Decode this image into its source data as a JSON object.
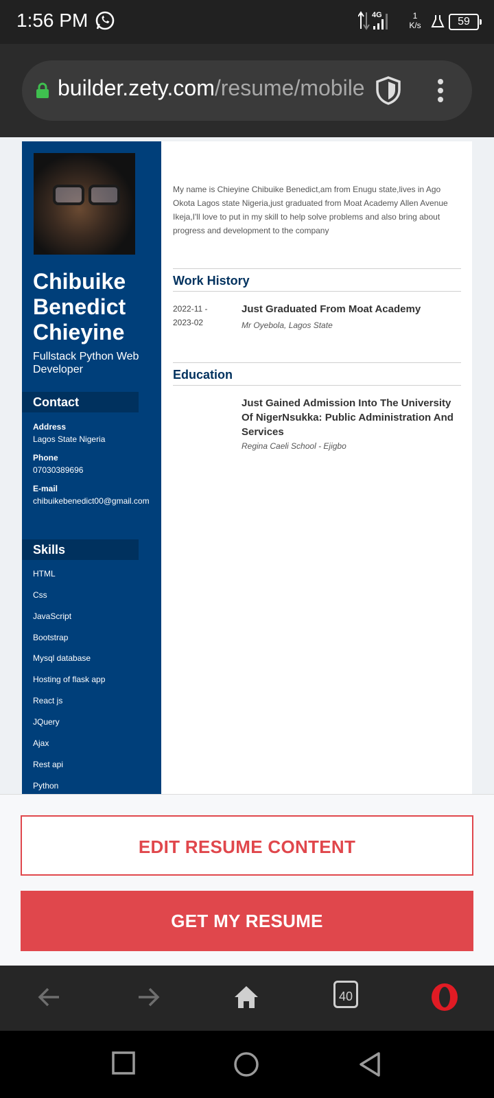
{
  "status_bar": {
    "time": "1:56 PM",
    "network": "4G",
    "speed_value": "1",
    "speed_unit": "K/s",
    "battery": "59"
  },
  "browser": {
    "url_host": "builder.zety.com",
    "url_path": "/resume/mobile",
    "tab_count": "40"
  },
  "resume": {
    "name": "Chibuike Benedict Chieyine",
    "role": "Fullstack Python Web Developer",
    "summary": "My name is Chieyine Chibuike Benedict,am from Enugu state,lives in Ago Okota Lagos state Nigeria,just graduated from Moat Academy Allen Avenue Ikeja,I'll love to put in my skill to help solve problems and also bring about progress and development to the company",
    "contact": {
      "heading": "Contact",
      "address_label": "Address",
      "address": "Lagos State Nigeria",
      "phone_label": "Phone",
      "phone": "07030389696",
      "email_label": "E-mail",
      "email": "chibuikebenedict00@gmail.com"
    },
    "skills": {
      "heading": "Skills",
      "items": [
        "HTML",
        "Css",
        "JavaScript",
        "Bootstrap",
        "Mysql database",
        "Hosting of flask app",
        "React js",
        "JQuery",
        "Ajax",
        "Rest api",
        "Python"
      ]
    },
    "work_history": {
      "heading": "Work History",
      "date_start": "2022-11 -",
      "date_end": "2023-02",
      "title": "Just Graduated From Moat Academy",
      "sub": "Mr Oyebola, Lagos State"
    },
    "education": {
      "heading": "Education",
      "title": "Just Gained Admission Into The University Of NigerNsukka: Public Administration And Services",
      "sub": "Regina Caeli School - Ejigbo"
    }
  },
  "actions": {
    "edit_label": "EDIT RESUME CONTENT",
    "get_label": "GET MY RESUME"
  },
  "colors": {
    "sidebar": "#003f7a",
    "accent": "#e0474c",
    "heading": "#00315e"
  }
}
